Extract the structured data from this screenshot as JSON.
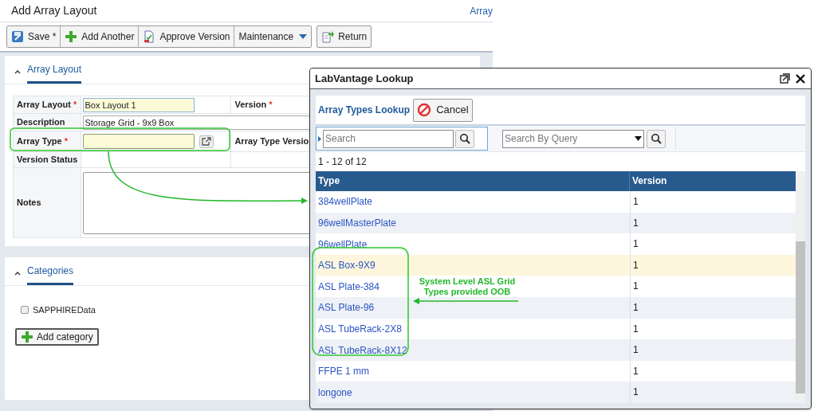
{
  "page": {
    "title": "Add Array Layout",
    "link": "Array"
  },
  "toolbar": [
    {
      "kind": "save",
      "label": "Save *"
    },
    {
      "kind": "add",
      "label": "Add Another"
    },
    {
      "kind": "approve",
      "label": "Approve Version"
    },
    {
      "kind": "menu",
      "label": "Maintenance"
    },
    {
      "kind": "return",
      "label": "Return"
    }
  ],
  "form": {
    "section": "Array Layout",
    "expanded": true,
    "required_mark": "*",
    "rows": [
      {
        "kind": "input",
        "label": "Array Layout",
        "required": true,
        "value": "Box Layout 1",
        "label_2": "Version",
        "required_2": true
      },
      {
        "kind": "text",
        "label": "Description",
        "required": false,
        "value": "Storage Grid - 9x9 Box"
      },
      {
        "kind": "lookup",
        "label": "Array Type",
        "required": true,
        "value": "",
        "label_2": "Array Type Versio",
        "required_2": false
      },
      {
        "kind": "empty",
        "label": "Version Status",
        "required": false
      },
      {
        "kind": "notes",
        "label": "Notes",
        "required": false
      }
    ]
  },
  "categories": {
    "section": "Categories",
    "expanded": true,
    "items": [
      {
        "label": "SAPPHIREData",
        "checked": false
      }
    ],
    "add_button": "Add category"
  },
  "lookup": {
    "title": "LabVantage Lookup",
    "heading": "Array Types Lookup",
    "cancel": "Cancel",
    "search": {
      "placeholder": "Search"
    },
    "query": {
      "placeholder": "Search By Query"
    },
    "count": "1 - 12 of 12",
    "columns": [
      "Type",
      "Version"
    ],
    "rows": [
      {
        "type": "384wellPlate",
        "version": "1",
        "selected": false
      },
      {
        "type": "96wellMasterPlate",
        "version": "1",
        "selected": false
      },
      {
        "type": "96wellPlate",
        "version": "1",
        "selected": false
      },
      {
        "type": "ASL Box-9X9",
        "version": "1",
        "selected": true
      },
      {
        "type": "ASL Plate-384",
        "version": "1",
        "selected": false
      },
      {
        "type": "ASL Plate-96",
        "version": "1",
        "selected": false
      },
      {
        "type": "ASL TubeRack-2X8",
        "version": "1",
        "selected": false
      },
      {
        "type": "ASL TubeRack-8X12",
        "version": "1",
        "selected": false
      },
      {
        "type": "FFPE 1 mm",
        "version": "1",
        "selected": false
      },
      {
        "type": "longone",
        "version": "1",
        "selected": false
      }
    ]
  },
  "annotation": {
    "text": "System Level ASL Grid Types provided OOB"
  }
}
